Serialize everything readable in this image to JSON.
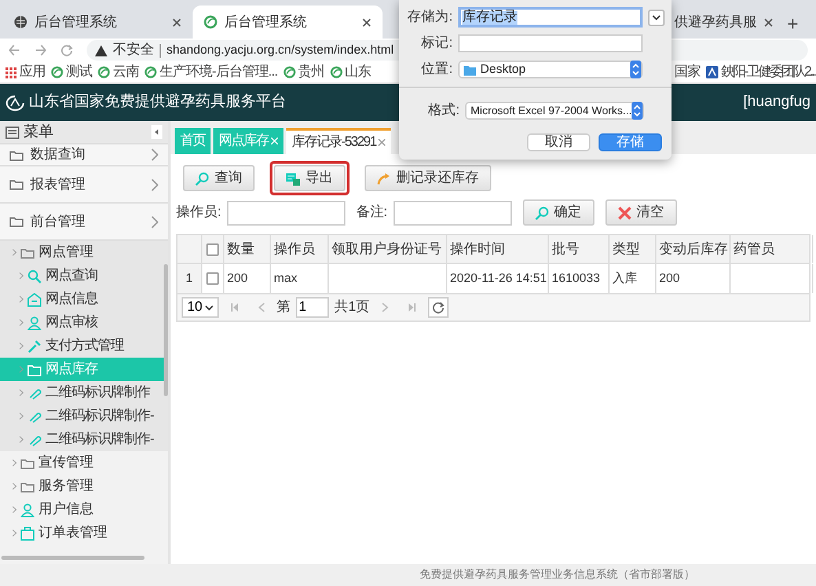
{
  "browser": {
    "tabs": [
      {
        "title": "后台管理系统",
        "selected": false
      },
      {
        "title": "后台管理系统",
        "selected": true
      },
      {
        "title": "供避孕药具服",
        "selected": false
      }
    ],
    "new_tab": "+",
    "address": {
      "security": "不安全",
      "url": "shandong.yacju.org.cn/system/index.html"
    },
    "bookmarks": [
      {
        "label": "应用"
      },
      {
        "label": "测试"
      },
      {
        "label": "云南"
      },
      {
        "label": "生产环境-后台管理..."
      },
      {
        "label": "贵州"
      },
      {
        "label": "山东"
      },
      {
        "label": "国家"
      },
      {
        "label": "鉠阳-卫健委团队2..."
      }
    ]
  },
  "app": {
    "title": "山东省国家免费提供避孕药具服务平台",
    "user": "[huangfug"
  },
  "sidebar": {
    "header": "菜单",
    "sections": [
      {
        "label": "数据查询"
      },
      {
        "label": "报表管理"
      },
      {
        "label": "前台管理"
      }
    ],
    "tree": [
      {
        "label": "网点管理",
        "selected": false,
        "children": [
          {
            "label": "网点查询",
            "selected": false
          },
          {
            "label": "网点信息",
            "selected": false
          },
          {
            "label": "网点审核",
            "selected": false
          },
          {
            "label": "支付方式管理",
            "selected": false
          },
          {
            "label": "网点库存",
            "selected": true
          },
          {
            "label": "二维码标识牌制作",
            "selected": false
          },
          {
            "label": "二维码标识牌制作-",
            "selected": false
          },
          {
            "label": "二维码标识牌制作-",
            "selected": false
          }
        ]
      },
      {
        "label": "宣传管理",
        "selected": false
      },
      {
        "label": "服务管理",
        "selected": false
      },
      {
        "label": "用户信息",
        "selected": false
      },
      {
        "label": "订单表管理",
        "selected": false
      }
    ]
  },
  "page_tabs": [
    {
      "label": "首页",
      "selected": false,
      "closable": false
    },
    {
      "label": "网点库存",
      "selected": false,
      "closable": true
    },
    {
      "label": "库存记录-53291",
      "selected": true,
      "closable": true
    }
  ],
  "toolbar": [
    {
      "label": "查询",
      "highlighted": false
    },
    {
      "label": "导出",
      "highlighted": true
    },
    {
      "label": "删记录还库存",
      "highlighted": false
    }
  ],
  "filters": [
    {
      "label": "操作员:"
    },
    {
      "label": "备注:"
    }
  ],
  "filter_buttons": [
    {
      "label": "确定"
    },
    {
      "label": "清空"
    }
  ],
  "table": {
    "header_checked": false,
    "columns": [
      "数量",
      "操作员",
      "领取用户身份证号",
      "操作时间",
      "批号",
      "类型",
      "变动后库存",
      "药管员"
    ],
    "rows": [
      {
        "index": "1",
        "checked": false,
        "cells": [
          "200",
          "max",
          "",
          "2020-11-26 14:51",
          "1610033",
          "入库",
          "200",
          ""
        ]
      }
    ]
  },
  "pager": {
    "page_size": "10",
    "before": "第",
    "page": "1",
    "total": "共1页"
  },
  "dialog": {
    "save_as": {
      "label": "存储为:",
      "value": "库存记录"
    },
    "tags": {
      "label": "标记:"
    },
    "location": {
      "label": "位置:",
      "value": "Desktop"
    },
    "format": {
      "label": "格式:",
      "value": "Microsoft Excel 97-2004 Works..."
    },
    "buttons": [
      {
        "label": "取消",
        "kind": "default"
      },
      {
        "label": "存储",
        "kind": "primary"
      }
    ]
  },
  "footer": "免费提供避孕药具服务管理业务信息系统（省市部署版）"
}
